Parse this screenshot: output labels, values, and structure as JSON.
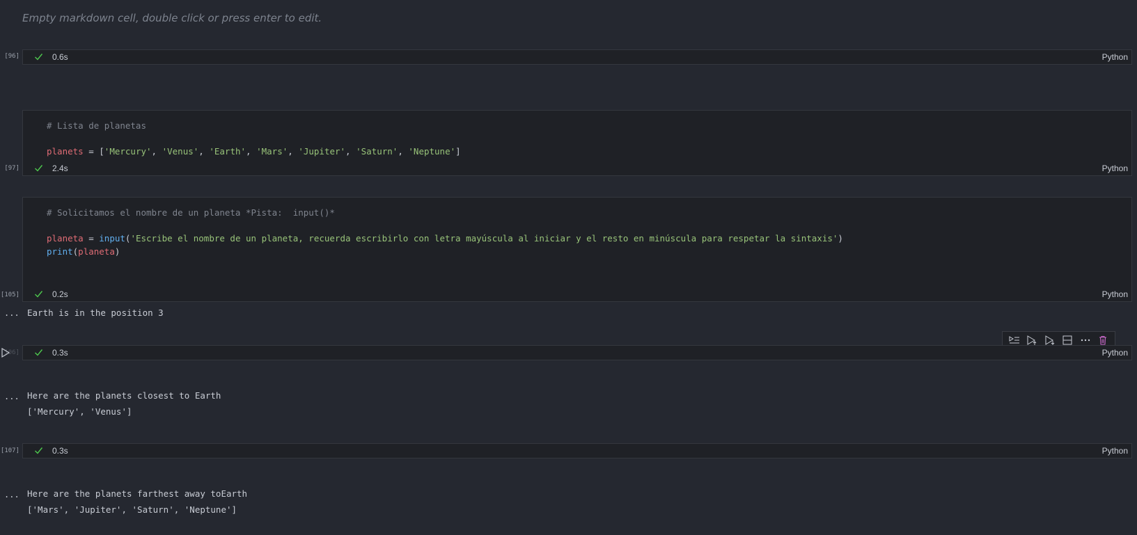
{
  "markdown_placeholder": "Empty markdown cell, double click or press enter to edit.",
  "cells": {
    "c96": {
      "count": "[96]",
      "duration": "0.6s",
      "language": "Python"
    },
    "c97": {
      "count": "[97]",
      "duration": "2.4s",
      "language": "Python",
      "comment": "# Lista de planetas",
      "var": "planets",
      "assign": " = [",
      "items": [
        "'Mercury'",
        "'Venus'",
        "'Earth'",
        "'Mars'",
        "'Jupiter'",
        "'Saturn'",
        "'Neptune'"
      ],
      "sep": ", ",
      "close": "]"
    },
    "c105": {
      "count": "[105]",
      "duration": "0.2s",
      "language": "Python",
      "comment": "# Solicitamos el nombre de un planeta *Pista:  input()*",
      "var": "planeta",
      "assign": " = ",
      "func_input": "input",
      "open_paren": "(",
      "prompt_str": "'Escribe el nombre de un planeta, recuerda escribirlo con letra mayúscula al iniciar y el resto en minúscula para respetar la sintaxis'",
      "close_paren": ")",
      "func_print": "print",
      "print_arg": "planeta",
      "output": "Earth is in the position 3"
    },
    "c106": {
      "count": "[106]",
      "duration": "0.3s",
      "language": "Python",
      "output_line1": "Here are the planets closest to Earth",
      "output_line2": "['Mercury', 'Venus']"
    },
    "c107": {
      "count": "[107]",
      "duration": "0.3s",
      "language": "Python",
      "output_line1": "Here are the planets farthest away toEarth",
      "output_line2": "['Mars', 'Jupiter', 'Saturn', 'Neptune']"
    }
  },
  "output_ellipsis": "...",
  "toolbar_icons": [
    "run-by-line-icon",
    "execute-above-icon",
    "execute-below-icon",
    "split-cell-icon",
    "more-icon",
    "delete-icon"
  ],
  "colors": {
    "background": "#252830",
    "cell": "#1f2126",
    "check": "#4ec94e",
    "delete": "#d16dd1"
  }
}
